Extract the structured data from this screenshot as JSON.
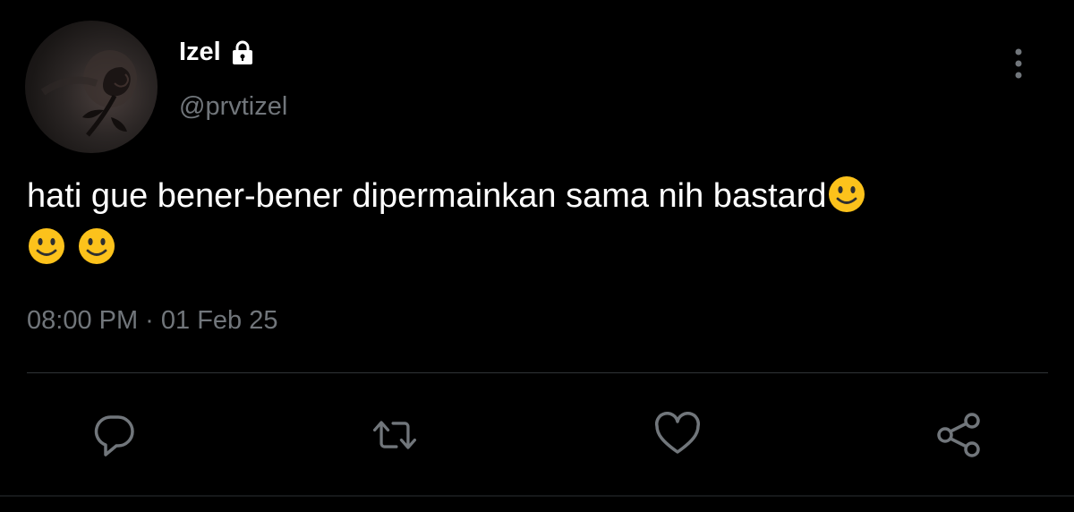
{
  "user": {
    "display_name": "Izel",
    "handle": "@prvtizel",
    "avatar_icon": "avatar-rose-photo",
    "protected_icon": "lock-icon"
  },
  "tweet": {
    "text": "hati gue bener-bener dipermainkan sama nih bastard",
    "emoji": [
      "slightly-smiling-face",
      "slightly-smiling-face",
      "slightly-smiling-face"
    ],
    "timestamp": "08:00 PM · 01 Feb 25"
  },
  "actions": [
    {
      "name": "reply",
      "icon": "reply-icon"
    },
    {
      "name": "retweet",
      "icon": "retweet-icon"
    },
    {
      "name": "like",
      "icon": "heart-icon"
    },
    {
      "name": "share",
      "icon": "share-icon"
    }
  ],
  "colors": {
    "background": "#000000",
    "primary_text": "#ffffff",
    "secondary_text": "#71767b",
    "icon": "#71767b",
    "divider": "#2f3336",
    "emoji_yellow": "#fcc21b"
  }
}
